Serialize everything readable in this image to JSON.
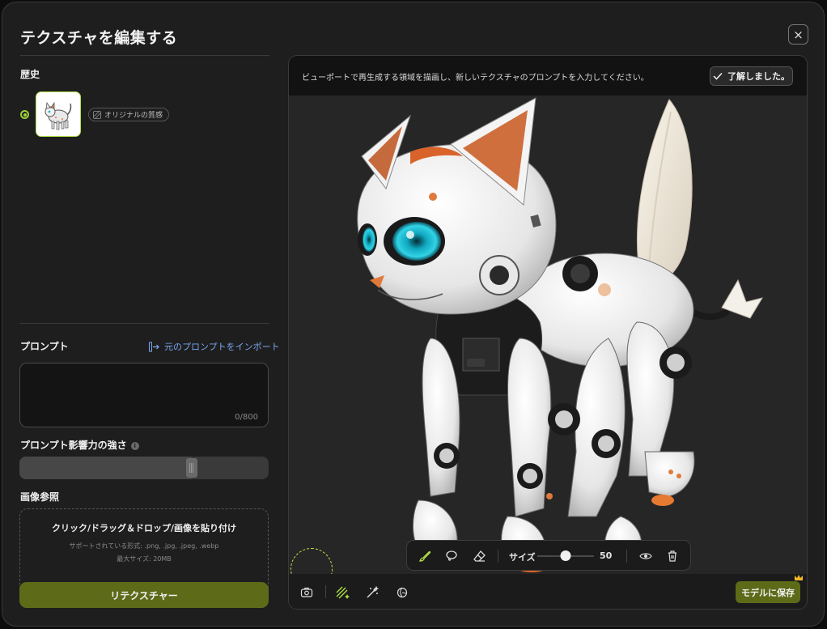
{
  "dialog": {
    "title": "テクスチャを編集する",
    "close_label": "×"
  },
  "history": {
    "label": "歴史",
    "items": [
      {
        "tag": "オリジナルの質感",
        "selected": true
      }
    ]
  },
  "prompt": {
    "label": "プロンプト",
    "import_label": "元のプロンプトをインポート",
    "value": "",
    "placeholder": "",
    "char_count": "0/800"
  },
  "strength": {
    "label": "プロンプト影響力の強さ",
    "info": "i",
    "value": 0.69
  },
  "image_reference": {
    "label": "画像参照",
    "drop_title": "クリック/ドラッグ＆ドロップ/画像を貼り付け",
    "formats": "サポートされている形式: .png, .jpg, .jpeg, .webp",
    "max_size": "最大サイズ: 20MB"
  },
  "retexture_button": "リテクスチャー",
  "viewport": {
    "banner_text": "ビューポートで再生成する領域を描画し、新しいテクスチャのプロンプトを入力してください。",
    "ack_label": "了解しました。"
  },
  "brush_toolbar": {
    "tools": [
      "brush-icon",
      "lasso-icon",
      "eraser-icon",
      "eye-icon",
      "trash-icon"
    ],
    "active_tool": "brush-icon",
    "size_label": "サイズ",
    "size_value": "50",
    "size_fraction": 0.5
  },
  "bottom_toolbar": {
    "tools": [
      "camera-icon",
      "texture-paint-icon",
      "magic-wand-icon",
      "material-icon"
    ],
    "save_label": "モデルに保存"
  },
  "colors": {
    "accent_green": "#9ad23a",
    "button_olive": "#5d6b19",
    "link_blue": "#7aa7f0"
  }
}
